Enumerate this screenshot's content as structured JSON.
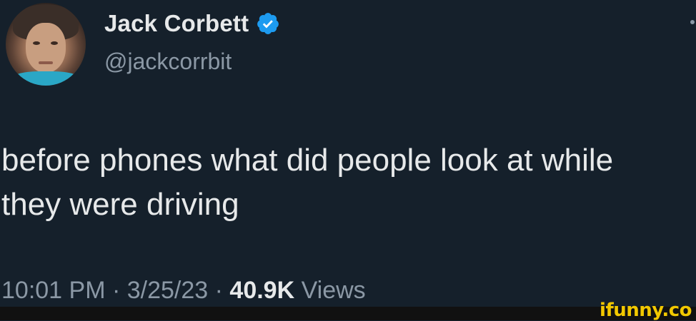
{
  "author": {
    "display_name": "Jack Corbett",
    "handle": "@jackcorrbit",
    "verified": true,
    "verified_color": "#1d9bf0"
  },
  "tweet": {
    "text": "before phones what did people look at while\nthey were driving"
  },
  "meta": {
    "time": "10:01 PM",
    "sep1": " · ",
    "date": "3/25/23",
    "sep2": " · ",
    "views_count": "40.9K",
    "views_label": " Views"
  },
  "watermark": {
    "text": "ifunny.co"
  },
  "colors": {
    "background": "#15202b",
    "primary_text": "#e7e9ea",
    "secondary_text": "#8b98a5",
    "watermark": "#f2c800"
  }
}
